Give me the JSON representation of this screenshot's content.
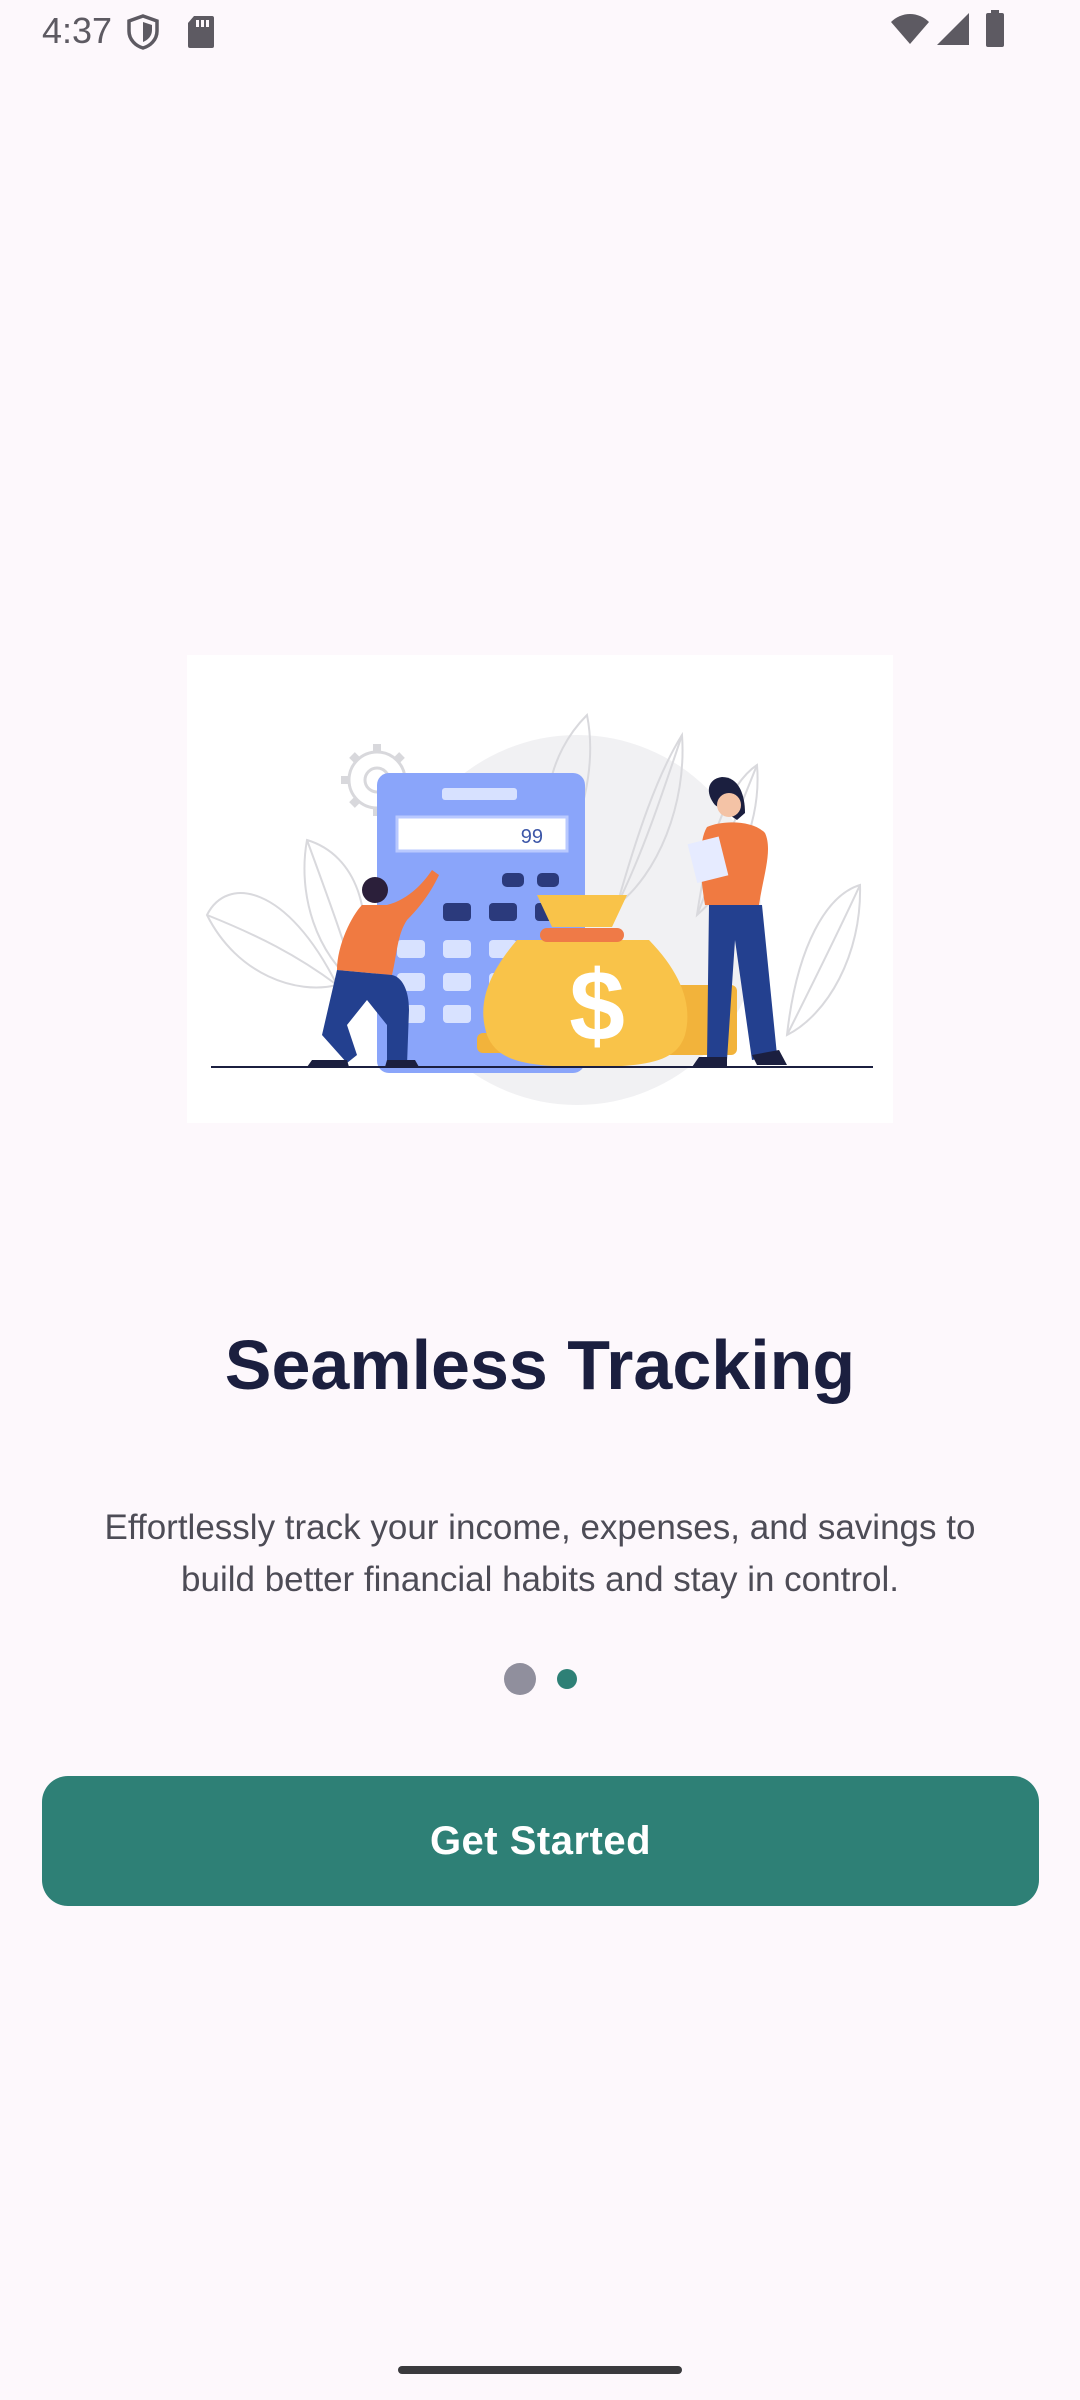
{
  "status_bar": {
    "time": "4:37",
    "left_icons": [
      "shield-icon",
      "sd-card-icon"
    ],
    "right_icons": [
      "wifi-icon",
      "cellular-signal-icon",
      "battery-icon"
    ]
  },
  "illustration": {
    "semantic": "finance-tracking-illustration",
    "calculator_display": "99",
    "money_bag_symbol": "$"
  },
  "content": {
    "title": "Seamless Tracking",
    "description": "Effortlessly track your income, expenses, and savings to build better financial habits and stay in control."
  },
  "pager": {
    "total_pages": 2,
    "current_page": 2
  },
  "actions": {
    "primary_label": "Get Started"
  },
  "colors": {
    "background": "#fdf8fc",
    "primary": "#2e8076",
    "title": "#1b1f3f",
    "body_text": "#4d4c56",
    "dot_inactive": "#908f9d"
  }
}
